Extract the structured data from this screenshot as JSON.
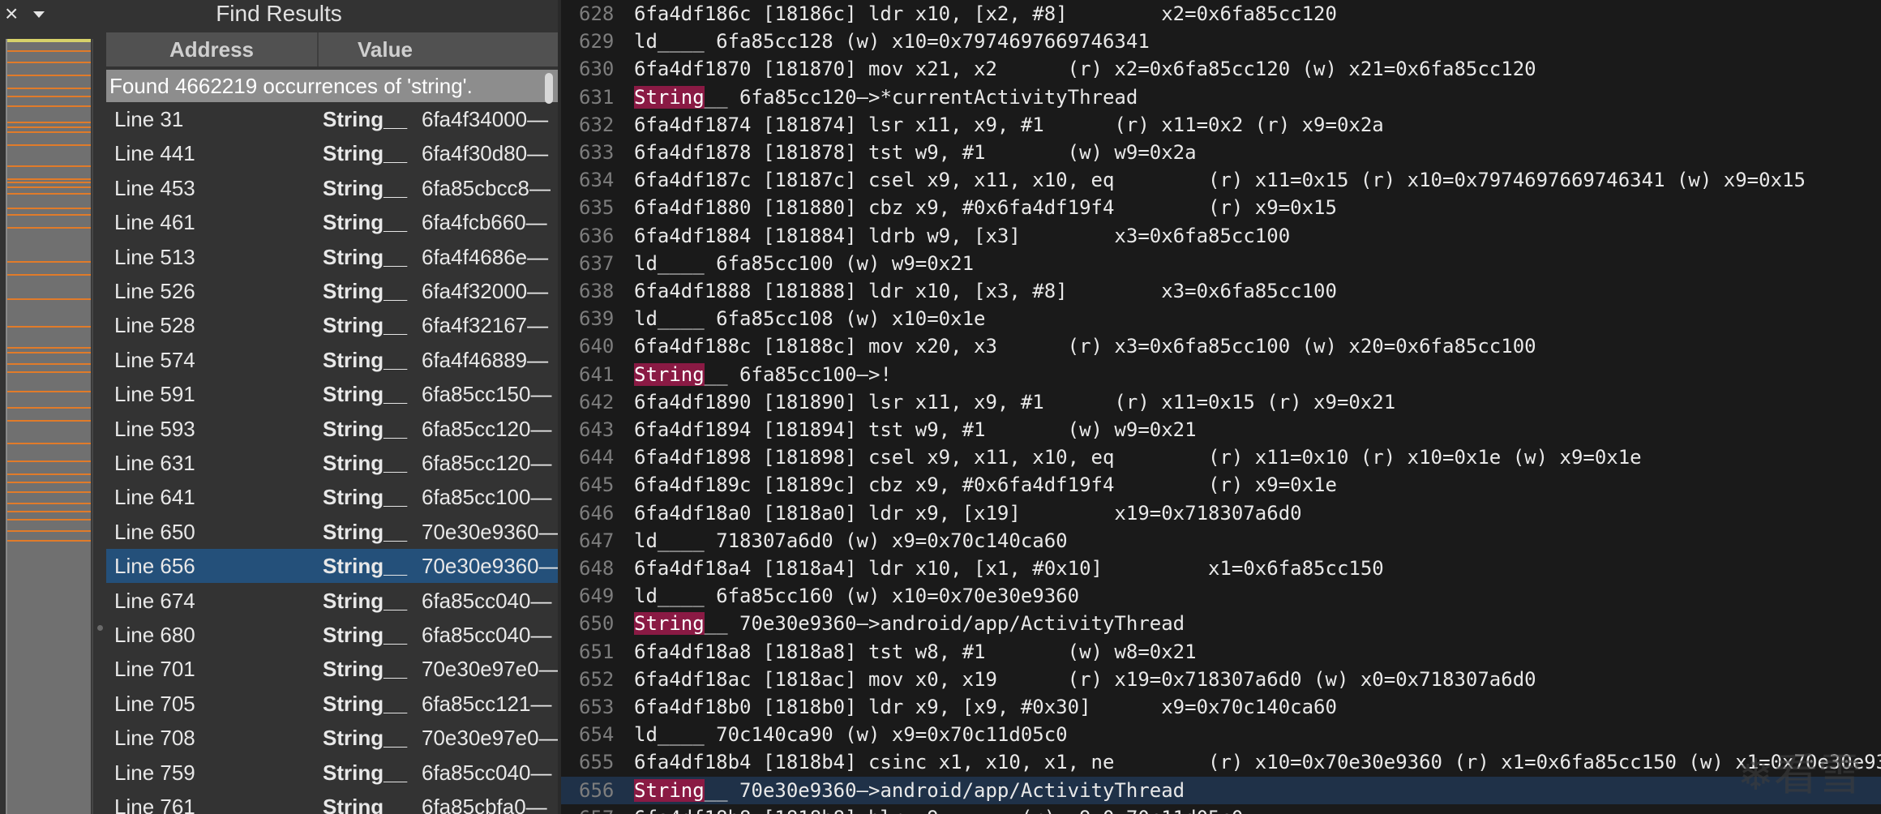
{
  "find_panel": {
    "title": "Find Results",
    "close_icon": "×",
    "columns": {
      "address": "Address",
      "value": "Value"
    },
    "found_text": "Found 4662219 occurrences of 'string'.",
    "results": [
      {
        "line": "Line 31",
        "kind": "String__",
        "value": "6fa4f34000—"
      },
      {
        "line": "Line 441",
        "kind": "String__",
        "value": "6fa4f30d80—"
      },
      {
        "line": "Line 453",
        "kind": "String__",
        "value": "6fa85cbcc8—"
      },
      {
        "line": "Line 461",
        "kind": "String__",
        "value": "6fa4fcb660—"
      },
      {
        "line": "Line 513",
        "kind": "String__",
        "value": "6fa4f4686e—"
      },
      {
        "line": "Line 526",
        "kind": "String__",
        "value": "6fa4f32000—"
      },
      {
        "line": "Line 528",
        "kind": "String__",
        "value": "6fa4f32167—"
      },
      {
        "line": "Line 574",
        "kind": "String__",
        "value": "6fa4f46889—"
      },
      {
        "line": "Line 591",
        "kind": "String__",
        "value": "6fa85cc150—"
      },
      {
        "line": "Line 593",
        "kind": "String__",
        "value": "6fa85cc120—"
      },
      {
        "line": "Line 631",
        "kind": "String__",
        "value": "6fa85cc120—"
      },
      {
        "line": "Line 641",
        "kind": "String__",
        "value": "6fa85cc100—"
      },
      {
        "line": "Line 650",
        "kind": "String__",
        "value": "70e30e9360—"
      },
      {
        "line": "Line 656",
        "kind": "String__",
        "value": "70e30e9360—",
        "selected": true
      },
      {
        "line": "Line 674",
        "kind": "String__",
        "value": "6fa85cc040—"
      },
      {
        "line": "Line 680",
        "kind": "String__",
        "value": "6fa85cc040—"
      },
      {
        "line": "Line 701",
        "kind": "String__",
        "value": "70e30e97e0—"
      },
      {
        "line": "Line 705",
        "kind": "String__",
        "value": "6fa85cc121—"
      },
      {
        "line": "Line 708",
        "kind": "String__",
        "value": "70e30e97e0—"
      },
      {
        "line": "Line 759",
        "kind": "String__",
        "value": "6fa85cc040—"
      },
      {
        "line": "Line 761",
        "kind": "String__",
        "value": "6fa85cbfa0—"
      }
    ]
  },
  "code_view": {
    "current_line": "656",
    "lines": [
      {
        "no": "628",
        "text": "6fa4df186c [18186c] ldr x10, [x2, #8]        x2=0x6fa85cc120"
      },
      {
        "no": "629",
        "text": "ld____ 6fa85cc128 (w) x10=0x7974697669746341"
      },
      {
        "no": "630",
        "text": "6fa4df1870 [181870] mov x21, x2      (r) x2=0x6fa85cc120 (w) x21=0x6fa85cc120"
      },
      {
        "no": "631",
        "kw": "String",
        "text": "__ 6fa85cc120—>*currentActivityThread"
      },
      {
        "no": "632",
        "text": "6fa4df1874 [181874] lsr x11, x9, #1      (r) x11=0x2 (r) x9=0x2a"
      },
      {
        "no": "633",
        "text": "6fa4df1878 [181878] tst w9, #1       (w) w9=0x2a"
      },
      {
        "no": "634",
        "text": "6fa4df187c [18187c] csel x9, x11, x10, eq        (r) x11=0x15 (r) x10=0x7974697669746341 (w) x9=0x15"
      },
      {
        "no": "635",
        "text": "6fa4df1880 [181880] cbz x9, #0x6fa4df19f4        (r) x9=0x15"
      },
      {
        "no": "636",
        "text": "6fa4df1884 [181884] ldrb w9, [x3]        x3=0x6fa85cc100"
      },
      {
        "no": "637",
        "text": "ld____ 6fa85cc100 (w) w9=0x21"
      },
      {
        "no": "638",
        "text": "6fa4df1888 [181888] ldr x10, [x3, #8]        x3=0x6fa85cc100"
      },
      {
        "no": "639",
        "text": "ld____ 6fa85cc108 (w) x10=0x1e"
      },
      {
        "no": "640",
        "text": "6fa4df188c [18188c] mov x20, x3      (r) x3=0x6fa85cc100 (w) x20=0x6fa85cc100"
      },
      {
        "no": "641",
        "kw": "String",
        "text": "__ 6fa85cc100—>!"
      },
      {
        "no": "642",
        "text": "6fa4df1890 [181890] lsr x11, x9, #1      (r) x11=0x15 (r) x9=0x21"
      },
      {
        "no": "643",
        "text": "6fa4df1894 [181894] tst w9, #1       (w) w9=0x21"
      },
      {
        "no": "644",
        "text": "6fa4df1898 [181898] csel x9, x11, x10, eq        (r) x11=0x10 (r) x10=0x1e (w) x9=0x1e"
      },
      {
        "no": "645",
        "text": "6fa4df189c [18189c] cbz x9, #0x6fa4df19f4        (r) x9=0x1e"
      },
      {
        "no": "646",
        "text": "6fa4df18a0 [1818a0] ldr x9, [x19]        x19=0x718307a6d0"
      },
      {
        "no": "647",
        "text": "ld____ 718307a6d0 (w) x9=0x70c140ca60"
      },
      {
        "no": "648",
        "text": "6fa4df18a4 [1818a4] ldr x10, [x1, #0x10]         x1=0x6fa85cc150"
      },
      {
        "no": "649",
        "text": "ld____ 6fa85cc160 (w) x10=0x70e30e9360"
      },
      {
        "no": "650",
        "kw": "String",
        "text": "__ 70e30e9360—>android/app/ActivityThread"
      },
      {
        "no": "651",
        "text": "6fa4df18a8 [1818a8] tst w8, #1       (w) w8=0x21"
      },
      {
        "no": "652",
        "text": "6fa4df18ac [1818ac] mov x0, x19      (r) x19=0x718307a6d0 (w) x0=0x718307a6d0"
      },
      {
        "no": "653",
        "text": "6fa4df18b0 [1818b0] ldr x9, [x9, #0x30]      x9=0x70c140ca60"
      },
      {
        "no": "654",
        "text": "ld____ 70c140ca90 (w) x9=0x70c11d05c0"
      },
      {
        "no": "655",
        "text": "6fa4df18b4 [1818b4] csinc x1, x10, x1, ne        (r) x10=0x70e30e9360 (r) x1=0x6fa85cc150 (w) x1=0x70e30e9360"
      },
      {
        "no": "656",
        "kw": "String",
        "text": "__ 70e30e9360—>android/app/ActivityThread"
      },
      {
        "no": "657",
        "text": "6fa4df18b8 [1818b8] blr x9       (r) x9=0x70c11d05c0"
      }
    ]
  },
  "watermark": "看雪",
  "icons": {
    "close": "close-icon",
    "menu": "chevron-down-icon",
    "watermark": "snowflake-icon"
  },
  "colors": {
    "string_highlight": "#8a1a44",
    "selected_row": "#24507a",
    "current_line": "#1f3148",
    "minimap_mark": "#e07b2a"
  }
}
